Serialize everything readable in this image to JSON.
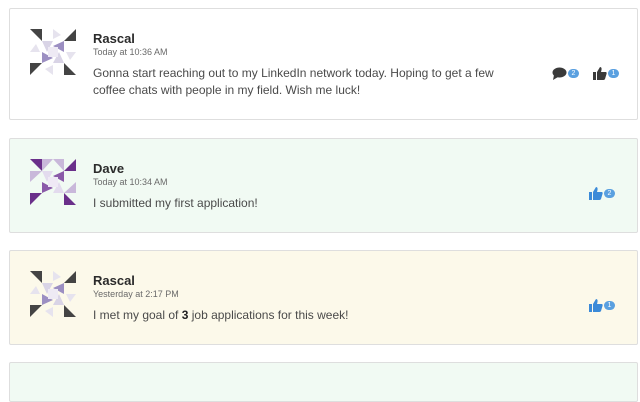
{
  "posts": [
    {
      "author": "Rascal",
      "time": "Today at 10:36 AM",
      "message": "Gonna start reaching out to my LinkedIn network today. Hoping to get a few coffee chats with people in my field. Wish me luck!",
      "comment_count": "2",
      "like_count": "1",
      "background": "#ffffff",
      "icon_color": "#3a3a3a",
      "badge_color": "#5aa0e0",
      "avatar_colors": [
        "#444444",
        "#9c8fc2"
      ]
    },
    {
      "author": "Dave",
      "time": "Today at 10:34 AM",
      "message": "I submitted my first application!",
      "like_count": "2",
      "background": "#f1faf3",
      "icon_color": "#3b8ad8",
      "badge_color": "#5aa0e0",
      "avatar_colors": [
        "#6a2f8a",
        "#c9b8da"
      ]
    },
    {
      "author": "Rascal",
      "time": "Yesterday at 2:17 PM",
      "message_before": "I met my goal of ",
      "message_bold": "3",
      "message_after": " job applications for this week!",
      "like_count": "1",
      "background": "#fcf9ea",
      "icon_color": "#3b8ad8",
      "badge_color": "#5aa0e0",
      "avatar_colors": [
        "#444444",
        "#9c8fc2"
      ]
    }
  ]
}
